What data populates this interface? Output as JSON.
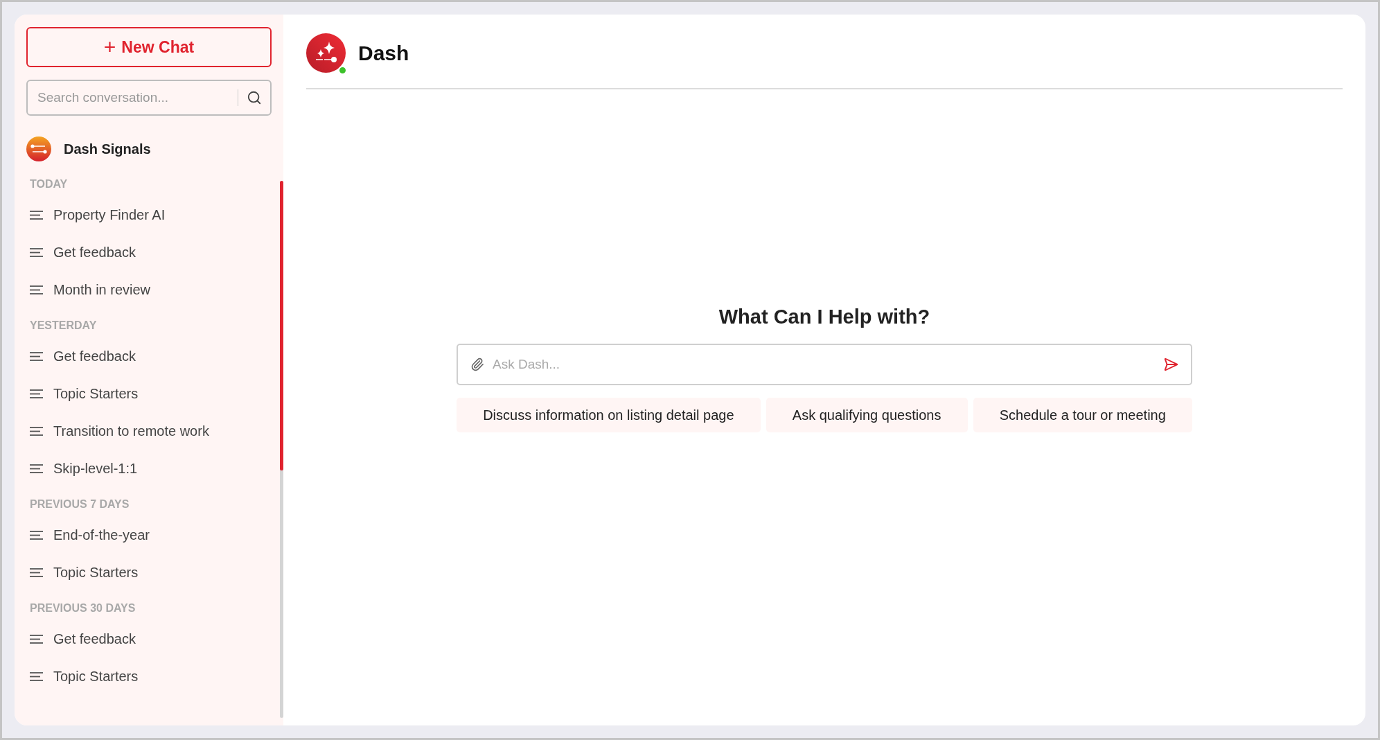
{
  "sidebar": {
    "new_chat_button": {
      "icon": "+",
      "label": "New Chat"
    },
    "search": {
      "placeholder": "Search conversation..."
    },
    "workspace": {
      "name": "Dash Signals"
    },
    "sections": [
      {
        "label": "TODAY",
        "items": [
          {
            "label": "Property Finder AI"
          },
          {
            "label": "Get feedback"
          },
          {
            "label": "Month in review"
          }
        ]
      },
      {
        "label": "YESTERDAY",
        "items": [
          {
            "label": "Get feedback"
          },
          {
            "label": "Topic Starters"
          },
          {
            "label": "Transition to remote work"
          },
          {
            "label": "Skip-level-1:1"
          }
        ]
      },
      {
        "label": "PREVIOUS 7 DAYS",
        "items": [
          {
            "label": "End-of-the-year"
          },
          {
            "label": "Topic Starters"
          }
        ]
      },
      {
        "label": "PREVIOUS 30 DAYS",
        "items": [
          {
            "label": "Get feedback"
          },
          {
            "label": "Topic Starters"
          }
        ]
      }
    ]
  },
  "header": {
    "title": "Dash",
    "online": true
  },
  "main": {
    "heading": "What Can I Help with?",
    "input": {
      "placeholder": "Ask Dash..."
    },
    "suggestions": [
      "Discuss information on listing detail page",
      "Ask qualifying questions",
      "Schedule a tour or meeting"
    ]
  }
}
